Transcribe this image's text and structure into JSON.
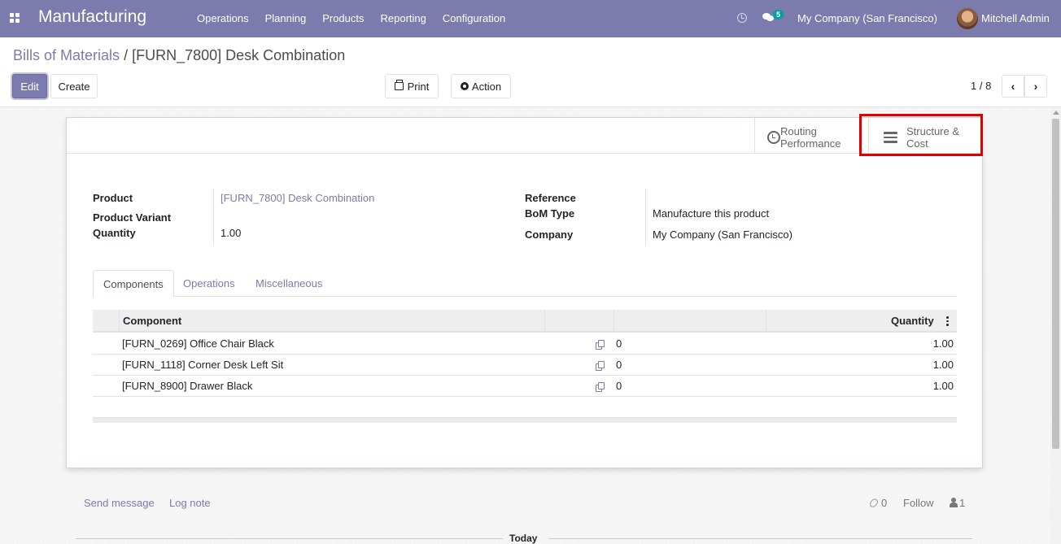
{
  "navbar": {
    "app_title": "Manufacturing",
    "menu": [
      "Operations",
      "Planning",
      "Products",
      "Reporting",
      "Configuration"
    ],
    "messages_badge": "5",
    "company": "My Company (San Francisco)",
    "user": "Mitchell Admin",
    "accent_color": "#7c7bad"
  },
  "breadcrumb": {
    "parent": "Bills of Materials",
    "separator": "/",
    "current": "[FURN_7800] Desk Combination"
  },
  "toolbar": {
    "edit_label": "Edit",
    "create_label": "Create",
    "print_label": "Print",
    "action_label": "Action"
  },
  "pager": {
    "value": "1 / 8"
  },
  "smart_buttons": {
    "routing": {
      "line1": "Routing",
      "line2": "Performance"
    },
    "structure": {
      "line1": "Structure &",
      "line2": "Cost"
    }
  },
  "form": {
    "product_label": "Product",
    "product_value": "[FURN_7800] Desk Combination",
    "variant_label": "Product Variant",
    "quantity_label": "Quantity",
    "quantity_value": "1.00",
    "reference_label": "Reference",
    "bom_type_label": "BoM Type",
    "bom_type_value": "Manufacture this product",
    "company_label": "Company",
    "company_value": "My Company (San Francisco)"
  },
  "tabs": [
    "Components",
    "Operations",
    "Miscellaneous"
  ],
  "table": {
    "col_component": "Component",
    "col_quantity": "Quantity",
    "rows": [
      {
        "component": "[FURN_0269] Office Chair Black",
        "ops": "0",
        "quantity": "1.00"
      },
      {
        "component": "[FURN_1118] Corner Desk Left Sit",
        "ops": "0",
        "quantity": "1.00"
      },
      {
        "component": "[FURN_8900] Drawer Black",
        "ops": "0",
        "quantity": "1.00"
      }
    ]
  },
  "chatter": {
    "send_message": "Send message",
    "log_note": "Log note",
    "attachments": "0",
    "follow": "Follow",
    "followers": "1",
    "today": "Today"
  }
}
